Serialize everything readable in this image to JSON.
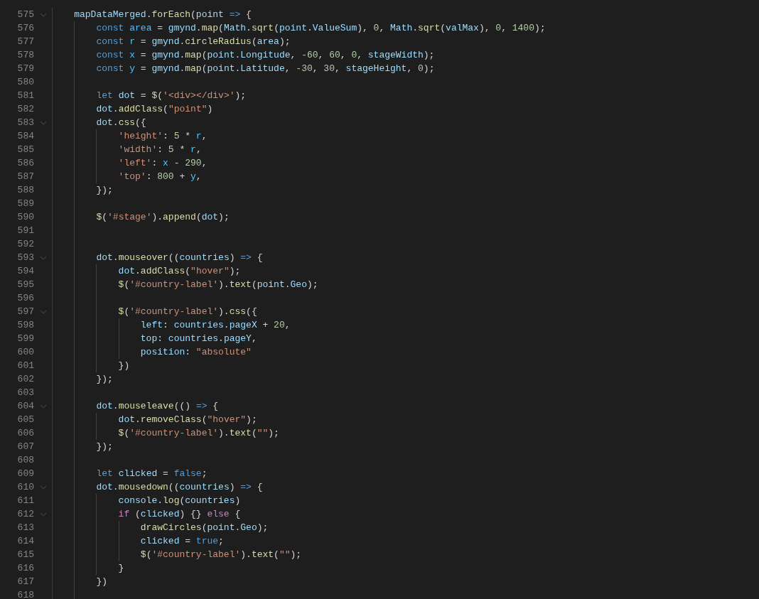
{
  "editor": {
    "lines": [
      {
        "number": "575",
        "foldable": true,
        "tokens": [
          {
            "kind": "variable",
            "text": "    mapDataMerged"
          },
          {
            "kind": "plain",
            "text": "."
          },
          {
            "kind": "function",
            "text": "forEach"
          },
          {
            "kind": "plain",
            "text": "("
          },
          {
            "kind": "variable",
            "text": "point"
          },
          {
            "kind": "keyword",
            "text": " =>"
          },
          {
            "kind": "plain",
            "text": " {"
          }
        ]
      },
      {
        "number": "576",
        "foldable": false,
        "tokens": [
          {
            "kind": "keyword",
            "text": "        const"
          },
          {
            "kind": "constant",
            "text": " area"
          },
          {
            "kind": "plain",
            "text": " = "
          },
          {
            "kind": "variable",
            "text": "gmynd"
          },
          {
            "kind": "plain",
            "text": "."
          },
          {
            "kind": "function",
            "text": "map"
          },
          {
            "kind": "plain",
            "text": "("
          },
          {
            "kind": "variable",
            "text": "Math"
          },
          {
            "kind": "plain",
            "text": "."
          },
          {
            "kind": "function",
            "text": "sqrt"
          },
          {
            "kind": "plain",
            "text": "("
          },
          {
            "kind": "variable",
            "text": "point"
          },
          {
            "kind": "plain",
            "text": "."
          },
          {
            "kind": "variable",
            "text": "ValueSum"
          },
          {
            "kind": "plain",
            "text": "), "
          },
          {
            "kind": "number",
            "text": "0"
          },
          {
            "kind": "plain",
            "text": ", "
          },
          {
            "kind": "variable",
            "text": "Math"
          },
          {
            "kind": "plain",
            "text": "."
          },
          {
            "kind": "function",
            "text": "sqrt"
          },
          {
            "kind": "plain",
            "text": "("
          },
          {
            "kind": "variable",
            "text": "valMax"
          },
          {
            "kind": "plain",
            "text": "), "
          },
          {
            "kind": "number",
            "text": "0"
          },
          {
            "kind": "plain",
            "text": ", "
          },
          {
            "kind": "number",
            "text": "1400"
          },
          {
            "kind": "plain",
            "text": ");"
          }
        ]
      },
      {
        "number": "577",
        "foldable": false,
        "tokens": [
          {
            "kind": "keyword",
            "text": "        const"
          },
          {
            "kind": "constant",
            "text": " r"
          },
          {
            "kind": "plain",
            "text": " = "
          },
          {
            "kind": "variable",
            "text": "gmynd"
          },
          {
            "kind": "plain",
            "text": "."
          },
          {
            "kind": "function",
            "text": "circleRadius"
          },
          {
            "kind": "plain",
            "text": "("
          },
          {
            "kind": "variable",
            "text": "area"
          },
          {
            "kind": "plain",
            "text": ");"
          }
        ]
      },
      {
        "number": "578",
        "foldable": false,
        "tokens": [
          {
            "kind": "keyword",
            "text": "        const"
          },
          {
            "kind": "constant",
            "text": " x"
          },
          {
            "kind": "plain",
            "text": " = "
          },
          {
            "kind": "variable",
            "text": "gmynd"
          },
          {
            "kind": "plain",
            "text": "."
          },
          {
            "kind": "function",
            "text": "map"
          },
          {
            "kind": "plain",
            "text": "("
          },
          {
            "kind": "variable",
            "text": "point"
          },
          {
            "kind": "plain",
            "text": "."
          },
          {
            "kind": "variable",
            "text": "Longitude"
          },
          {
            "kind": "plain",
            "text": ", "
          },
          {
            "kind": "number",
            "text": "-60"
          },
          {
            "kind": "plain",
            "text": ", "
          },
          {
            "kind": "number",
            "text": "60"
          },
          {
            "kind": "plain",
            "text": ", "
          },
          {
            "kind": "number",
            "text": "0"
          },
          {
            "kind": "plain",
            "text": ", "
          },
          {
            "kind": "variable",
            "text": "stageWidth"
          },
          {
            "kind": "plain",
            "text": ");"
          }
        ]
      },
      {
        "number": "579",
        "foldable": false,
        "tokens": [
          {
            "kind": "keyword",
            "text": "        const"
          },
          {
            "kind": "constant",
            "text": " y"
          },
          {
            "kind": "plain",
            "text": " = "
          },
          {
            "kind": "variable",
            "text": "gmynd"
          },
          {
            "kind": "plain",
            "text": "."
          },
          {
            "kind": "function",
            "text": "map"
          },
          {
            "kind": "plain",
            "text": "("
          },
          {
            "kind": "variable",
            "text": "point"
          },
          {
            "kind": "plain",
            "text": "."
          },
          {
            "kind": "variable",
            "text": "Latitude"
          },
          {
            "kind": "plain",
            "text": ", "
          },
          {
            "kind": "number",
            "text": "-30"
          },
          {
            "kind": "plain",
            "text": ", "
          },
          {
            "kind": "number",
            "text": "30"
          },
          {
            "kind": "plain",
            "text": ", "
          },
          {
            "kind": "variable",
            "text": "stageHeight"
          },
          {
            "kind": "plain",
            "text": ", "
          },
          {
            "kind": "number",
            "text": "0"
          },
          {
            "kind": "plain",
            "text": ");"
          }
        ]
      },
      {
        "number": "580",
        "foldable": false
      },
      {
        "number": "581",
        "foldable": false,
        "tokens": [
          {
            "kind": "keyword",
            "text": "        let"
          },
          {
            "kind": "variable",
            "text": " dot"
          },
          {
            "kind": "plain",
            "text": " = "
          },
          {
            "kind": "function",
            "text": "$"
          },
          {
            "kind": "plain",
            "text": "("
          },
          {
            "kind": "string",
            "text": "'<div></div>'"
          },
          {
            "kind": "plain",
            "text": ");"
          }
        ]
      },
      {
        "number": "582",
        "foldable": false,
        "tokens": [
          {
            "kind": "variable",
            "text": "        dot"
          },
          {
            "kind": "plain",
            "text": "."
          },
          {
            "kind": "function",
            "text": "addClass"
          },
          {
            "kind": "plain",
            "text": "("
          },
          {
            "kind": "string",
            "text": "\"point\""
          },
          {
            "kind": "plain",
            "text": ")"
          }
        ]
      },
      {
        "number": "583",
        "foldable": true,
        "tokens": [
          {
            "kind": "variable",
            "text": "        dot"
          },
          {
            "kind": "plain",
            "text": "."
          },
          {
            "kind": "function",
            "text": "css"
          },
          {
            "kind": "plain",
            "text": "({"
          }
        ]
      },
      {
        "number": "584",
        "foldable": false,
        "tokens": [
          {
            "kind": "string",
            "text": "            'height'"
          },
          {
            "kind": "plain",
            "text": ": "
          },
          {
            "kind": "number",
            "text": "5"
          },
          {
            "kind": "plain",
            "text": " * "
          },
          {
            "kind": "constant",
            "text": "r"
          },
          {
            "kind": "plain",
            "text": ","
          }
        ]
      },
      {
        "number": "585",
        "foldable": false,
        "tokens": [
          {
            "kind": "string",
            "text": "            'width'"
          },
          {
            "kind": "plain",
            "text": ": "
          },
          {
            "kind": "number",
            "text": "5"
          },
          {
            "kind": "plain",
            "text": " * "
          },
          {
            "kind": "constant",
            "text": "r"
          },
          {
            "kind": "plain",
            "text": ","
          }
        ]
      },
      {
        "number": "586",
        "foldable": false,
        "tokens": [
          {
            "kind": "string",
            "text": "            'left'"
          },
          {
            "kind": "plain",
            "text": ": "
          },
          {
            "kind": "constant",
            "text": "x"
          },
          {
            "kind": "plain",
            "text": " - "
          },
          {
            "kind": "number",
            "text": "290"
          },
          {
            "kind": "plain",
            "text": ","
          }
        ]
      },
      {
        "number": "587",
        "foldable": false,
        "tokens": [
          {
            "kind": "string",
            "text": "            'top'"
          },
          {
            "kind": "plain",
            "text": ": "
          },
          {
            "kind": "number",
            "text": "800"
          },
          {
            "kind": "plain",
            "text": " + "
          },
          {
            "kind": "constant",
            "text": "y"
          },
          {
            "kind": "plain",
            "text": ","
          }
        ]
      },
      {
        "number": "588",
        "foldable": false,
        "tokens": [
          {
            "kind": "plain",
            "text": "        });"
          }
        ]
      },
      {
        "number": "589",
        "foldable": false
      },
      {
        "number": "590",
        "foldable": false,
        "tokens": [
          {
            "kind": "function",
            "text": "        $"
          },
          {
            "kind": "plain",
            "text": "("
          },
          {
            "kind": "string",
            "text": "'#stage'"
          },
          {
            "kind": "plain",
            "text": ")."
          },
          {
            "kind": "function",
            "text": "append"
          },
          {
            "kind": "plain",
            "text": "("
          },
          {
            "kind": "variable",
            "text": "dot"
          },
          {
            "kind": "plain",
            "text": ");"
          }
        ]
      },
      {
        "number": "591",
        "foldable": false
      },
      {
        "number": "592",
        "foldable": false
      },
      {
        "number": "593",
        "foldable": true,
        "tokens": [
          {
            "kind": "variable",
            "text": "        dot"
          },
          {
            "kind": "plain",
            "text": "."
          },
          {
            "kind": "function",
            "text": "mouseover"
          },
          {
            "kind": "plain",
            "text": "(("
          },
          {
            "kind": "variable",
            "text": "countries"
          },
          {
            "kind": "plain",
            "text": ") "
          },
          {
            "kind": "keyword",
            "text": "=>"
          },
          {
            "kind": "plain",
            "text": " {"
          }
        ]
      },
      {
        "number": "594",
        "foldable": false,
        "tokens": [
          {
            "kind": "variable",
            "text": "            dot"
          },
          {
            "kind": "plain",
            "text": "."
          },
          {
            "kind": "function",
            "text": "addClass"
          },
          {
            "kind": "plain",
            "text": "("
          },
          {
            "kind": "string",
            "text": "\"hover\""
          },
          {
            "kind": "plain",
            "text": ");"
          }
        ]
      },
      {
        "number": "595",
        "foldable": false,
        "tokens": [
          {
            "kind": "function",
            "text": "            $"
          },
          {
            "kind": "plain",
            "text": "("
          },
          {
            "kind": "string",
            "text": "'#country-label'"
          },
          {
            "kind": "plain",
            "text": ")."
          },
          {
            "kind": "function",
            "text": "text"
          },
          {
            "kind": "plain",
            "text": "("
          },
          {
            "kind": "variable",
            "text": "point"
          },
          {
            "kind": "plain",
            "text": "."
          },
          {
            "kind": "variable",
            "text": "Geo"
          },
          {
            "kind": "plain",
            "text": ");"
          }
        ]
      },
      {
        "number": "596",
        "foldable": false
      },
      {
        "number": "597",
        "foldable": true,
        "tokens": [
          {
            "kind": "function",
            "text": "            $"
          },
          {
            "kind": "plain",
            "text": "("
          },
          {
            "kind": "string",
            "text": "'#country-label'"
          },
          {
            "kind": "plain",
            "text": ")."
          },
          {
            "kind": "function",
            "text": "css"
          },
          {
            "kind": "plain",
            "text": "({"
          }
        ]
      },
      {
        "number": "598",
        "foldable": false,
        "tokens": [
          {
            "kind": "variable",
            "text": "                left"
          },
          {
            "kind": "plain",
            "text": ": "
          },
          {
            "kind": "variable",
            "text": "countries"
          },
          {
            "kind": "plain",
            "text": "."
          },
          {
            "kind": "variable",
            "text": "pageX"
          },
          {
            "kind": "plain",
            "text": " + "
          },
          {
            "kind": "number",
            "text": "20"
          },
          {
            "kind": "plain",
            "text": ","
          }
        ]
      },
      {
        "number": "599",
        "foldable": false,
        "tokens": [
          {
            "kind": "variable",
            "text": "                top"
          },
          {
            "kind": "plain",
            "text": ": "
          },
          {
            "kind": "variable",
            "text": "countries"
          },
          {
            "kind": "plain",
            "text": "."
          },
          {
            "kind": "variable",
            "text": "pageY"
          },
          {
            "kind": "plain",
            "text": ","
          }
        ]
      },
      {
        "number": "600",
        "foldable": false,
        "tokens": [
          {
            "kind": "variable",
            "text": "                position"
          },
          {
            "kind": "plain",
            "text": ": "
          },
          {
            "kind": "string",
            "text": "\"absolute\""
          }
        ]
      },
      {
        "number": "601",
        "foldable": false,
        "tokens": [
          {
            "kind": "plain",
            "text": "            })"
          }
        ]
      },
      {
        "number": "602",
        "foldable": false,
        "tokens": [
          {
            "kind": "plain",
            "text": "        });"
          }
        ]
      },
      {
        "number": "603",
        "foldable": false
      },
      {
        "number": "604",
        "foldable": true,
        "tokens": [
          {
            "kind": "variable",
            "text": "        dot"
          },
          {
            "kind": "plain",
            "text": "."
          },
          {
            "kind": "function",
            "text": "mouseleave"
          },
          {
            "kind": "plain",
            "text": "(() "
          },
          {
            "kind": "keyword",
            "text": "=>"
          },
          {
            "kind": "plain",
            "text": " {"
          }
        ]
      },
      {
        "number": "605",
        "foldable": false,
        "tokens": [
          {
            "kind": "variable",
            "text": "            dot"
          },
          {
            "kind": "plain",
            "text": "."
          },
          {
            "kind": "function",
            "text": "removeClass"
          },
          {
            "kind": "plain",
            "text": "("
          },
          {
            "kind": "string",
            "text": "\"hover\""
          },
          {
            "kind": "plain",
            "text": ");"
          }
        ]
      },
      {
        "number": "606",
        "foldable": false,
        "tokens": [
          {
            "kind": "function",
            "text": "            $"
          },
          {
            "kind": "plain",
            "text": "("
          },
          {
            "kind": "string",
            "text": "'#country-label'"
          },
          {
            "kind": "plain",
            "text": ")."
          },
          {
            "kind": "function",
            "text": "text"
          },
          {
            "kind": "plain",
            "text": "("
          },
          {
            "kind": "string",
            "text": "\"\""
          },
          {
            "kind": "plain",
            "text": ");"
          }
        ]
      },
      {
        "number": "607",
        "foldable": false,
        "tokens": [
          {
            "kind": "plain",
            "text": "        });"
          }
        ]
      },
      {
        "number": "608",
        "foldable": false
      },
      {
        "number": "609",
        "foldable": false,
        "tokens": [
          {
            "kind": "keyword",
            "text": "        let"
          },
          {
            "kind": "variable",
            "text": " clicked"
          },
          {
            "kind": "plain",
            "text": " = "
          },
          {
            "kind": "keyword",
            "text": "false"
          },
          {
            "kind": "plain",
            "text": ";"
          }
        ]
      },
      {
        "number": "610",
        "foldable": true,
        "tokens": [
          {
            "kind": "variable",
            "text": "        dot"
          },
          {
            "kind": "plain",
            "text": "."
          },
          {
            "kind": "function",
            "text": "mousedown"
          },
          {
            "kind": "plain",
            "text": "(("
          },
          {
            "kind": "variable",
            "text": "countries"
          },
          {
            "kind": "plain",
            "text": ") "
          },
          {
            "kind": "keyword",
            "text": "=>"
          },
          {
            "kind": "plain",
            "text": " {"
          }
        ]
      },
      {
        "number": "611",
        "foldable": false,
        "tokens": [
          {
            "kind": "variable",
            "text": "            console"
          },
          {
            "kind": "plain",
            "text": "."
          },
          {
            "kind": "function",
            "text": "log"
          },
          {
            "kind": "plain",
            "text": "("
          },
          {
            "kind": "variable",
            "text": "countries"
          },
          {
            "kind": "plain",
            "text": ")"
          }
        ]
      },
      {
        "number": "612",
        "foldable": true,
        "tokens": [
          {
            "kind": "control",
            "text": "            if"
          },
          {
            "kind": "plain",
            "text": " ("
          },
          {
            "kind": "variable",
            "text": "clicked"
          },
          {
            "kind": "plain",
            "text": ") {} "
          },
          {
            "kind": "control",
            "text": "else"
          },
          {
            "kind": "plain",
            "text": " {"
          }
        ]
      },
      {
        "number": "613",
        "foldable": false,
        "tokens": [
          {
            "kind": "function",
            "text": "                drawCircles"
          },
          {
            "kind": "plain",
            "text": "("
          },
          {
            "kind": "variable",
            "text": "point"
          },
          {
            "kind": "plain",
            "text": "."
          },
          {
            "kind": "variable",
            "text": "Geo"
          },
          {
            "kind": "plain",
            "text": ");"
          }
        ]
      },
      {
        "number": "614",
        "foldable": false,
        "tokens": [
          {
            "kind": "variable",
            "text": "                clicked"
          },
          {
            "kind": "plain",
            "text": " = "
          },
          {
            "kind": "keyword",
            "text": "true"
          },
          {
            "kind": "plain",
            "text": ";"
          }
        ]
      },
      {
        "number": "615",
        "foldable": false,
        "tokens": [
          {
            "kind": "function",
            "text": "                $"
          },
          {
            "kind": "plain",
            "text": "("
          },
          {
            "kind": "string",
            "text": "'#country-label'"
          },
          {
            "kind": "plain",
            "text": ")."
          },
          {
            "kind": "function",
            "text": "text"
          },
          {
            "kind": "plain",
            "text": "("
          },
          {
            "kind": "string",
            "text": "\"\""
          },
          {
            "kind": "plain",
            "text": ");"
          }
        ]
      },
      {
        "number": "616",
        "foldable": false,
        "tokens": [
          {
            "kind": "plain",
            "text": "            }"
          }
        ]
      },
      {
        "number": "617",
        "foldable": false,
        "tokens": [
          {
            "kind": "plain",
            "text": "        })"
          }
        ]
      },
      {
        "number": "618",
        "foldable": false
      }
    ]
  }
}
